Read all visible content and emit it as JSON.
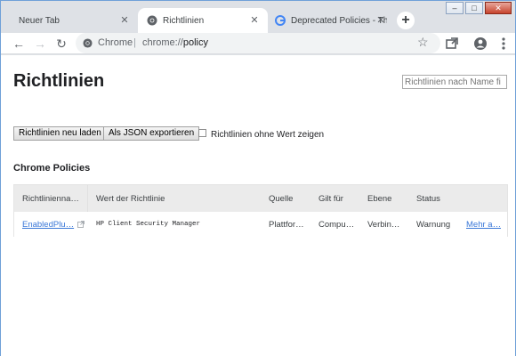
{
  "tabs": [
    {
      "title": "Neuer Tab"
    },
    {
      "title": "Richtlinien"
    },
    {
      "title": "Deprecated Policies - Th"
    }
  ],
  "toolbar": {
    "scheme_label": "Chrome",
    "divider": "|",
    "url_prefix": "chrome://",
    "url_path": "policy"
  },
  "page": {
    "title": "Richtlinien",
    "search_placeholder": "Richtlinien nach Name fi",
    "reload_button": "Richtlinien neu laden",
    "export_button": "Als JSON exportieren",
    "show_unset_label": "Richtlinien ohne Wert zeigen",
    "section_title": "Chrome Policies"
  },
  "table": {
    "headers": [
      "Richtlinienna…",
      "Wert der Richtlinie",
      "Quelle",
      "Gilt für",
      "Ebene",
      "Status"
    ],
    "rows": [
      {
        "name": "EnabledPlu…",
        "value": "HP Client Security Manager",
        "source": "Plattfor…",
        "scope": "Compu…",
        "level": "Verbin…",
        "status": "Warnung",
        "more": "Mehr a…"
      }
    ]
  },
  "colors": {
    "tab_strip": "#dee1e6",
    "link": "#3b78d8",
    "table_header": "#ebebeb"
  }
}
